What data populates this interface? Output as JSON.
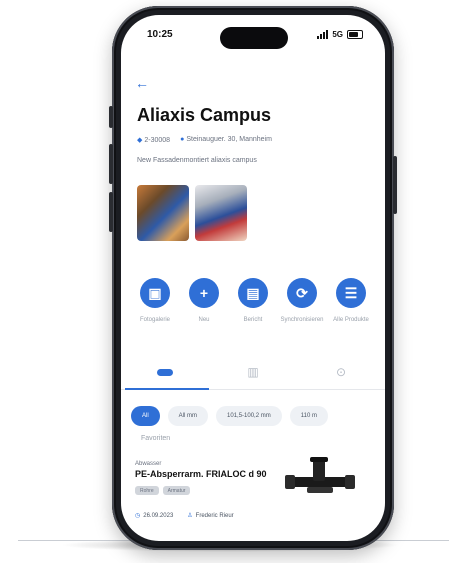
{
  "status_bar": {
    "time": "10:25"
  },
  "header": {
    "back_icon": "arrow-left-icon",
    "title": "Aliaxis Campus",
    "meta_id": "2-30008",
    "meta_location": "Steinauguer. 30, Mannheim",
    "description": "New Fassadenmontiert aliaxis campus"
  },
  "gallery": {
    "photos": [
      "photo-1",
      "photo-2"
    ]
  },
  "actions": [
    {
      "icon": "car-icon",
      "label": "Fotogalerie"
    },
    {
      "icon": "plus-icon",
      "label": "Neu"
    },
    {
      "icon": "document-icon",
      "label": "Bericht"
    },
    {
      "icon": "sync-icon",
      "label": "Synchronisieren"
    },
    {
      "icon": "list-icon",
      "label": "Alle Produkte"
    }
  ],
  "tabs": [
    {
      "icon": "pill-icon",
      "active": true
    },
    {
      "icon": "file-icon",
      "active": false
    },
    {
      "icon": "pin-icon",
      "active": false
    }
  ],
  "filters": [
    {
      "label": "All",
      "active": true
    },
    {
      "label": "All mm",
      "active": false
    },
    {
      "label": "101,5-100,2 mm",
      "active": false
    },
    {
      "label": "110 m",
      "active": false
    }
  ],
  "section_label": "Favoriten",
  "product_card": {
    "category": "Abwasser",
    "name": "PE-Absperrarm. FRIALOC d 90",
    "tags": [
      "Rohre",
      "Armatur"
    ],
    "date": "26.09.2023",
    "author": "Frederic Rieur"
  },
  "colors": {
    "accent": "#2f6fd6",
    "phone_frame": "#1b1d22"
  }
}
